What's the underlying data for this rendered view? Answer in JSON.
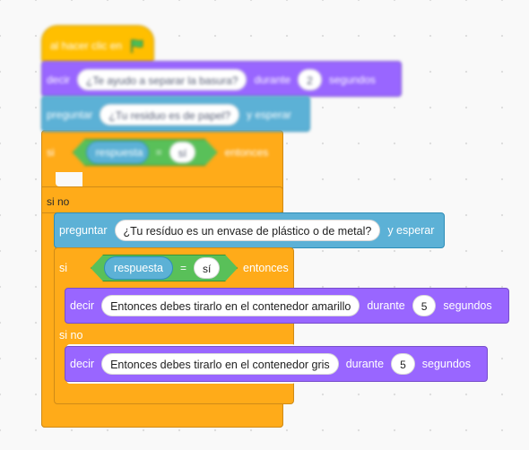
{
  "script": {
    "hat": {
      "label": "al hacer clic en",
      "icon": "green-flag-icon"
    },
    "say1": {
      "verb": "decir",
      "message": "¿Te ayudo a separar la basura?",
      "duration": "2",
      "unit": "segundos",
      "during": "durante"
    },
    "ask1": {
      "verb": "preguntar",
      "question": "¿Tu residuo es de papel?",
      "suffix": "y esperar"
    },
    "if1": {
      "if": "si",
      "reporter": "respuesta",
      "equals": "=",
      "value": "sí",
      "then": "entonces"
    },
    "else1": {
      "label": "si no"
    },
    "ask2": {
      "verb": "preguntar",
      "question": "¿Tu resíduo es un envase de plástico o de metal?",
      "suffix": "y esperar"
    },
    "if2": {
      "if": "si",
      "reporter": "respuesta",
      "equals": "=",
      "value": "sí",
      "then": "entonces"
    },
    "say2": {
      "verb": "decir",
      "message": "Entonces debes tirarlo en el contenedor amarillo",
      "during": "durante",
      "duration": "5",
      "unit": "segundos"
    },
    "else2": {
      "label": "si no"
    },
    "say3": {
      "verb": "decir",
      "message": "Entonces debes tirarlo en el contenedor gris",
      "during": "durante",
      "duration": "5",
      "unit": "segundos"
    }
  },
  "colors": {
    "events": "#ffbf00",
    "looks": "#9966ff",
    "sensing": "#5cb1d6",
    "control": "#ffab19",
    "operators": "#59c059",
    "flag": "#4cbf56"
  }
}
